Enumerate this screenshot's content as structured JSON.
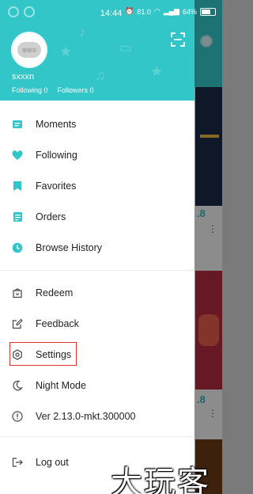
{
  "status_bar": {
    "time": "14:44",
    "network_speed": "81.0",
    "battery": "64%"
  },
  "profile": {
    "avatar_text": "审核中",
    "username": "sxxxn",
    "following": "Following 0",
    "followers": "Followers 0"
  },
  "menu": {
    "moments": "Moments",
    "following": "Following",
    "favorites": "Favorites",
    "orders": "Orders",
    "browse_history": "Browse History",
    "redeem": "Redeem",
    "feedback": "Feedback",
    "settings": "Settings",
    "night_mode": "Night Mode",
    "version": "Ver 2.13.0-mkt.300000",
    "log_out": "Log out"
  },
  "background": {
    "rating_1": ".8",
    "rating_2": ".8"
  },
  "watermark": "大玩客",
  "colors": {
    "accent": "#33c6c8",
    "highlight": "#e0342a"
  }
}
